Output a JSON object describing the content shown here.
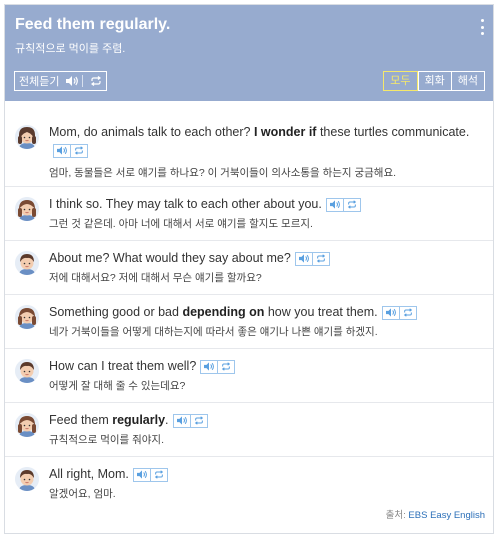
{
  "header": {
    "title": "Feed them regularly.",
    "subtitle": "규칙적으로 먹이를 주렴.",
    "listen_all_label": "전체듣기",
    "tabs": [
      "모두",
      "회화",
      "해석"
    ],
    "active_tab": "모두"
  },
  "dialogue": [
    {
      "speaker": "mom",
      "en_html": "Mom, do animals talk to each other? <b>I wonder if</b> these turtles communicate.",
      "ko": "엄마, 동물들은 서로 얘기를 하나요? 이 거북이들이 의사소통을 하는지 궁금해요."
    },
    {
      "speaker": "woman",
      "en_html": "I think so. They may talk to each other about you.",
      "ko": "그런 것 같은데. 아마 너에 대해서 서로 얘기를 할지도 모르지."
    },
    {
      "speaker": "boy",
      "en_html": "About me? What would they say about me?",
      "ko": "저에 대해서요? 저에 대해서 무슨 얘기를 할까요?"
    },
    {
      "speaker": "woman",
      "en_html": "Something good or bad <b>depending on</b> how you treat them.",
      "ko": "네가 거북이들을 어떻게 대하는지에 따라서 좋은 얘기나 나쁜 얘기를 하겠지."
    },
    {
      "speaker": "boy",
      "en_html": "How can I treat them well?",
      "ko": "어떻게 잘 대해 줄 수 있는데요?"
    },
    {
      "speaker": "woman",
      "en_html": "Feed them <b>regularly</b>.",
      "ko": "규칙적으로 먹이를 줘야지."
    },
    {
      "speaker": "boy",
      "en_html": "All right, Mom.",
      "ko": "알겠어요, 엄마."
    }
  ],
  "source": {
    "prefix": "출처:",
    "brand": "EBS Easy English"
  },
  "colors": {
    "header_bg": "#97abcf",
    "active_tab": "#f5e86a",
    "icon_blue": "#9ec6ec",
    "brand": "#2b6fb8"
  },
  "icons": {
    "speaker": "speaker-icon",
    "repeat": "repeat-icon",
    "menu": "kebab-menu-icon"
  }
}
